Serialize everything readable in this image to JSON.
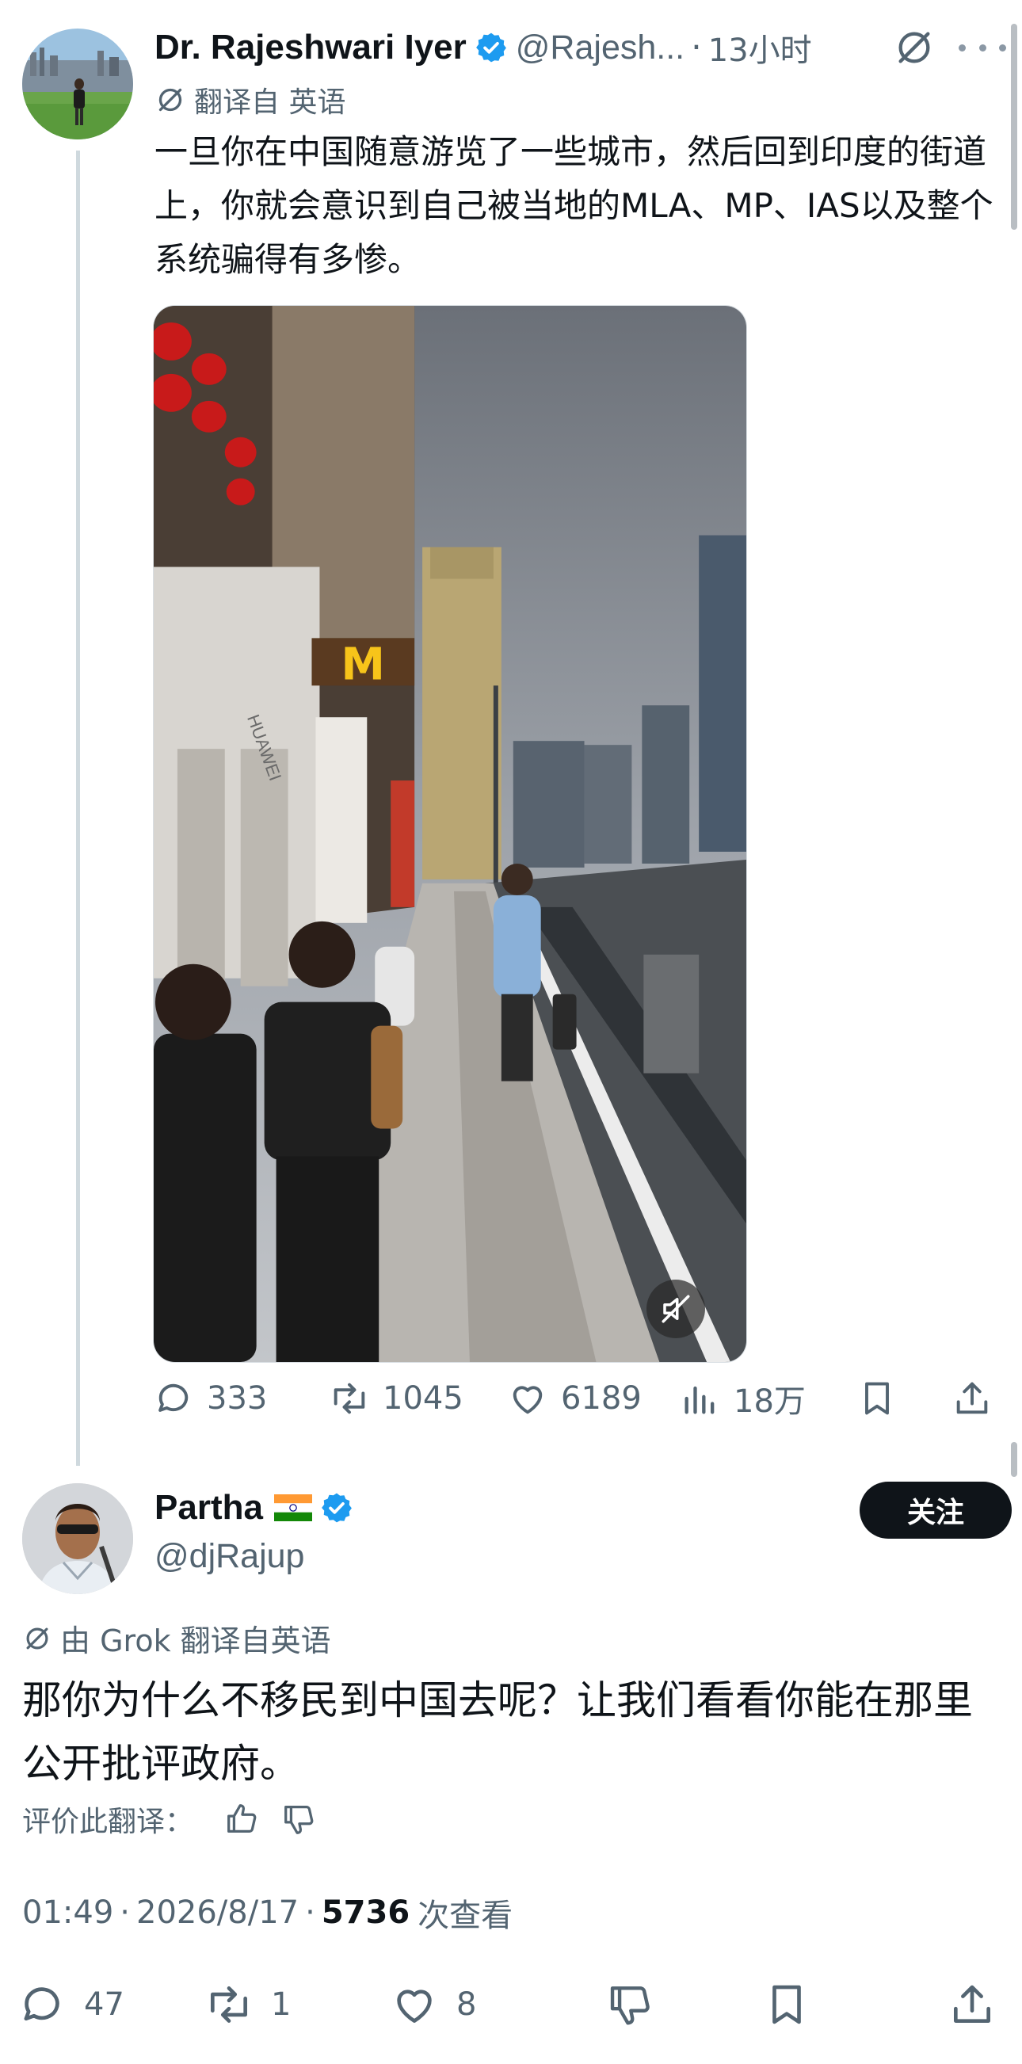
{
  "colors": {
    "text": "#0f1419",
    "secondary": "#536471",
    "verified": "#1d9bf0",
    "line": "#cfd9de"
  },
  "tweet": {
    "author_name": "Dr. Rajeshwari Iyer",
    "handle": "@Rajesh...",
    "dot": "·",
    "time": "13小时",
    "translated_label": "翻译自 英语",
    "text": "一旦你在中国随意游览了一些城市，然后回到印度的街道上，你就会意识到自己被当地的MLA、MP、IAS以及整个系统骗得有多惨。",
    "media_sign_text": "HUAWEI",
    "actions": {
      "replies": "333",
      "reposts": "1045",
      "likes": "6189",
      "views": "18万"
    },
    "icons": [
      "grok-icon",
      "more-icon",
      "verified-icon",
      "reply-icon",
      "repost-icon",
      "like-icon",
      "views-icon",
      "bookmark-icon",
      "share-icon",
      "mute-icon"
    ]
  },
  "reply": {
    "author_name": "Partha",
    "flag": "india-flag",
    "handle": "@djRajup",
    "follow_label": "关注",
    "translated_by": "由 Grok 翻译自英语",
    "text": "那你为什么不移民到中国去呢？让我们看看你能在那里公开批评政府。",
    "rate_label": "评价此翻译：",
    "time": "01:49",
    "date": "2026/8/17",
    "separator": "·",
    "views_count": "5736",
    "views_label": "次查看",
    "actions": {
      "replies": "47",
      "reposts": "1",
      "likes": "8"
    }
  }
}
